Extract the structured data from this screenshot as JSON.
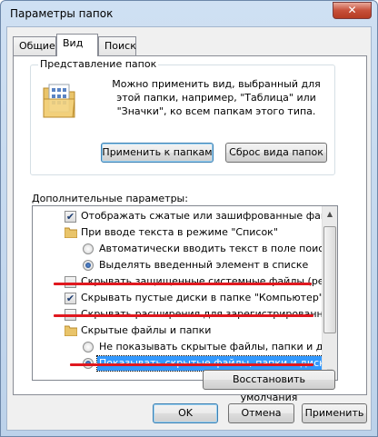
{
  "window": {
    "title": "Параметры папок",
    "close_glyph": "✕"
  },
  "tabs": [
    {
      "label": "Общие",
      "active": false
    },
    {
      "label": "Вид",
      "active": true
    },
    {
      "label": "Поиск",
      "active": false
    }
  ],
  "folder_views": {
    "caption": "Представление папок",
    "description": "Можно применить вид, выбранный для этой папки, например, \"Таблица\" или \"Значки\", ко всем папкам этого типа.",
    "apply_label": "Применить к папкам",
    "reset_label": "Сброс вида папок"
  },
  "advanced": {
    "label": "Дополнительные параметры:",
    "items": [
      {
        "type": "checkbox",
        "checked": true,
        "label": "Отображать сжатые или зашифрованные файлы NTFS другим цветом"
      },
      {
        "type": "folder",
        "label": "При вводе текста в режиме \"Список\""
      },
      {
        "type": "radio",
        "checked": false,
        "label": "Автоматически вводить текст в поле поиска"
      },
      {
        "type": "radio",
        "checked": true,
        "label": "Выделять введенный элемент в списке"
      },
      {
        "type": "checkbox",
        "checked": false,
        "label": "Скрывать защищенные системные файлы (рекомендуется)"
      },
      {
        "type": "checkbox",
        "checked": true,
        "label": "Скрывать пустые диски в папке \"Компьютер\""
      },
      {
        "type": "checkbox",
        "checked": false,
        "label": "Скрывать расширения для зарегистрированных типов файлов"
      },
      {
        "type": "folder",
        "label": "Скрытые файлы и папки"
      },
      {
        "type": "radio",
        "checked": false,
        "label": "Не показывать скрытые файлы, папки и диски"
      },
      {
        "type": "radio",
        "checked": true,
        "selected": true,
        "label": "Показывать скрытые файлы, папки и диски"
      }
    ],
    "restore_label": "Восстановить умолчания"
  },
  "footer": {
    "ok_label": "OK",
    "cancel_label": "Отмена",
    "apply_label": "Применить"
  },
  "colors": {
    "annotation_red": "#e0181f",
    "selection_blue": "#3399ff"
  }
}
